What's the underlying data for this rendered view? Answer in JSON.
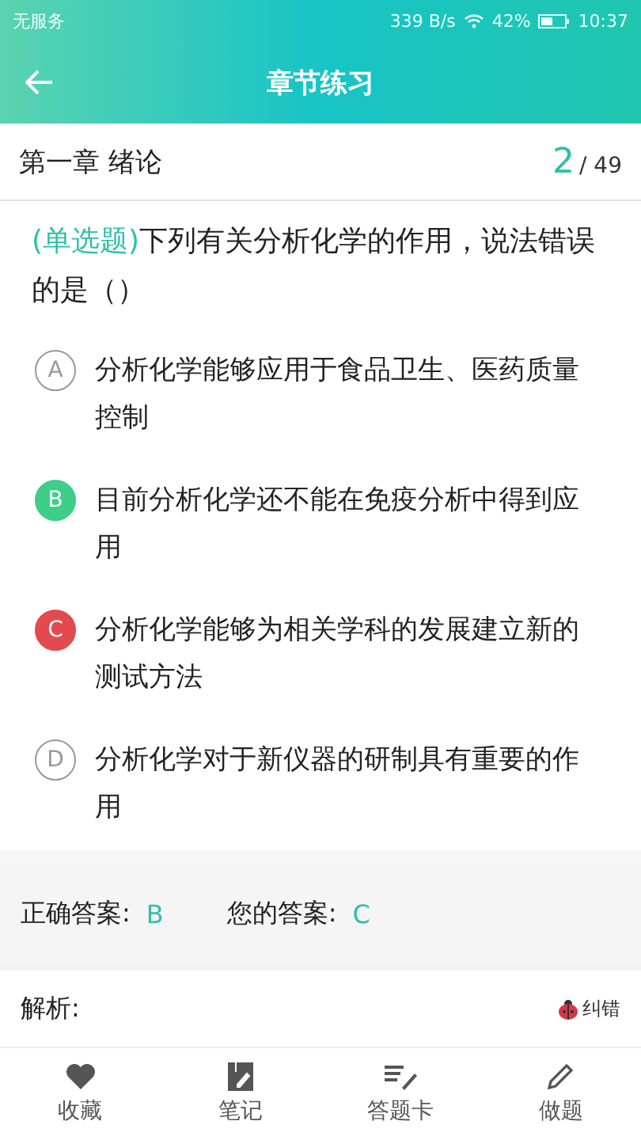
{
  "status_bar": {
    "carrier": "无服务",
    "speed": "339 B/s",
    "battery": "42%",
    "time": "10:37"
  },
  "header": {
    "title": "章节练习"
  },
  "chapter": {
    "title": "第一章 绪论",
    "current": "2",
    "total": "/ 49"
  },
  "question": {
    "type_label": "(单选题)",
    "text": "下列有关分析化学的作用，说法错误的是（）"
  },
  "options": [
    {
      "letter": "A",
      "text": "分析化学能够应用于食品卫生、医药质量控制",
      "kind": "normal"
    },
    {
      "letter": "B",
      "text": "目前分析化学还不能在免疫分析中得到应用",
      "kind": "correct"
    },
    {
      "letter": "C",
      "text": "分析化学能够为相关学科的发展建立新的测试方法",
      "kind": "wrong"
    },
    {
      "letter": "D",
      "text": "分析化学对于新仪器的研制具有重要的作用",
      "kind": "normal"
    }
  ],
  "answer": {
    "correct_label": "正确答案:",
    "correct": "B",
    "yours_label": "您的答案:",
    "yours": "C"
  },
  "analysis": {
    "label": "解析:",
    "report": "纠错"
  },
  "nav": [
    {
      "label": "收藏",
      "kind": "favorite"
    },
    {
      "label": "笔记",
      "kind": "notes"
    },
    {
      "label": "答题卡",
      "kind": "answer_card"
    },
    {
      "label": "做题",
      "kind": "practice"
    }
  ]
}
